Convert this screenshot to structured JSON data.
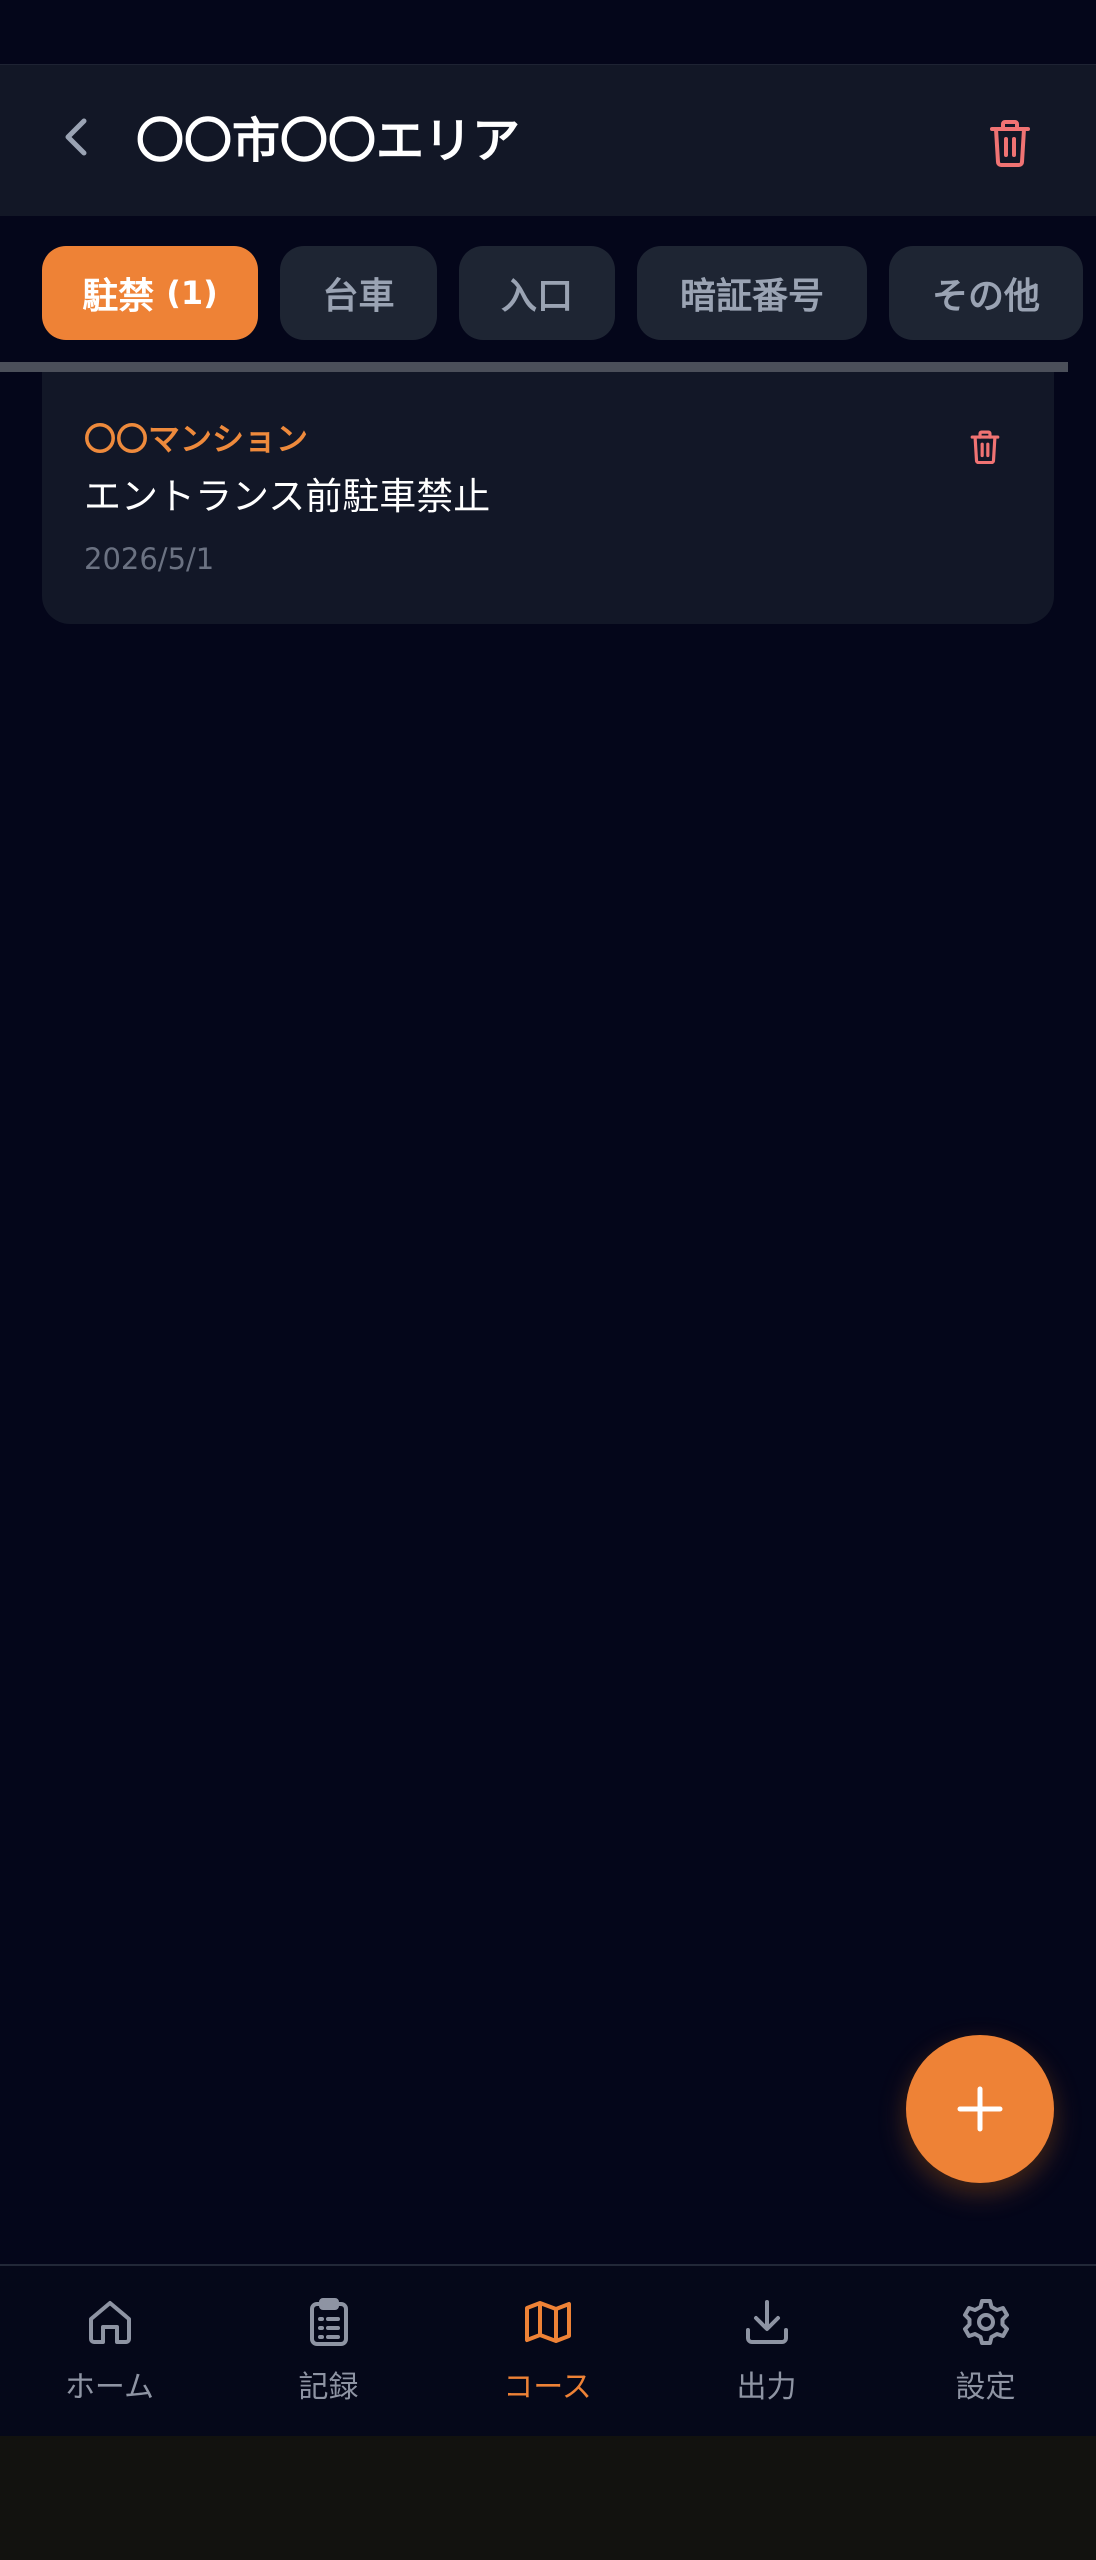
{
  "header": {
    "title": "〇〇市〇〇エリア",
    "back_icon": "chevron-left-icon",
    "delete_icon": "trash-icon"
  },
  "tabs": [
    {
      "label": "駐禁",
      "count": "(1)",
      "active": true
    },
    {
      "label": "台車",
      "count": "",
      "active": false
    },
    {
      "label": "入口",
      "count": "",
      "active": false
    },
    {
      "label": "暗証番号",
      "count": "",
      "active": false
    },
    {
      "label": "その他",
      "count": "",
      "active": false
    }
  ],
  "notes": [
    {
      "place": "〇〇マンション",
      "text": "エントランス前駐車禁止",
      "date": "2026/5/1",
      "delete_icon": "trash-icon"
    }
  ],
  "fab": {
    "icon": "plus-icon"
  },
  "bottom_nav": [
    {
      "label": "ホーム",
      "icon": "home-icon",
      "active": false
    },
    {
      "label": "記録",
      "icon": "clipboard-list-icon",
      "active": false
    },
    {
      "label": "コース",
      "icon": "map-icon",
      "active": true
    },
    {
      "label": "出力",
      "icon": "download-icon",
      "active": false
    },
    {
      "label": "設定",
      "icon": "gear-icon",
      "active": false
    }
  ],
  "colors": {
    "accent": "#ee8236",
    "background": "#04061a",
    "surface": "#121727",
    "tab_inactive": "#1e2533",
    "danger": "#f07373",
    "muted_text": "#8e94a3"
  }
}
